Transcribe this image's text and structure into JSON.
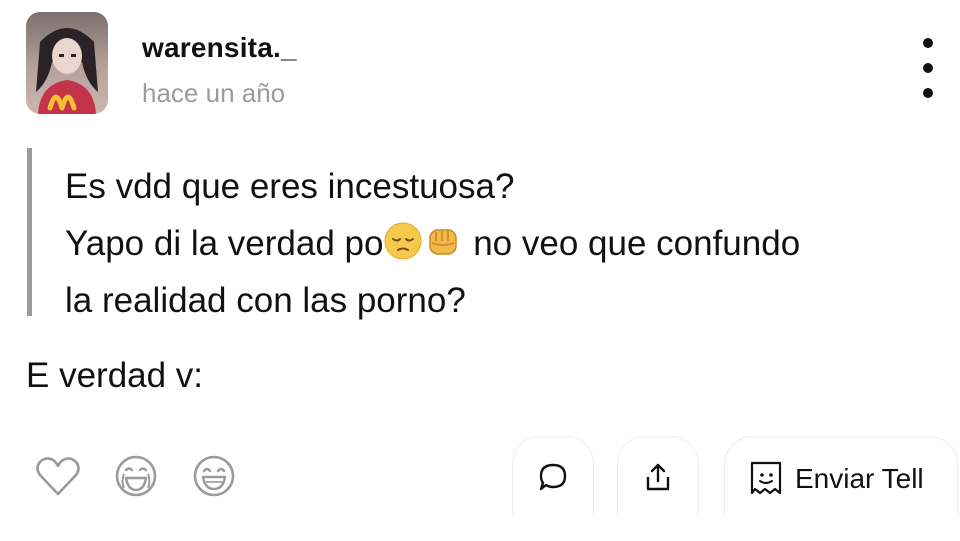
{
  "post": {
    "username": "warensita._",
    "timestamp": "hace un año",
    "quote_lines": [
      "Es vdd que eres incestuosa?",
      "Yapo di la verdad po",
      "no veo que confundo",
      "la realidad con las porno?"
    ],
    "body": "E verdad v:"
  },
  "reactions": {
    "icons": [
      "heart-icon",
      "crying-laughing-icon",
      "laughing-icon"
    ]
  },
  "actions": {
    "comment_icon": "comment-bubble-icon",
    "share_icon": "share-upload-icon",
    "send_icon": "tellonym-send-icon",
    "send_label": "Enviar Tell"
  },
  "colors": {
    "text": "#111111",
    "muted": "#9b9b9b",
    "quote_bar": "#9a9a9a",
    "icon_gray": "#9a9a9a",
    "button_border": "#ececec"
  }
}
